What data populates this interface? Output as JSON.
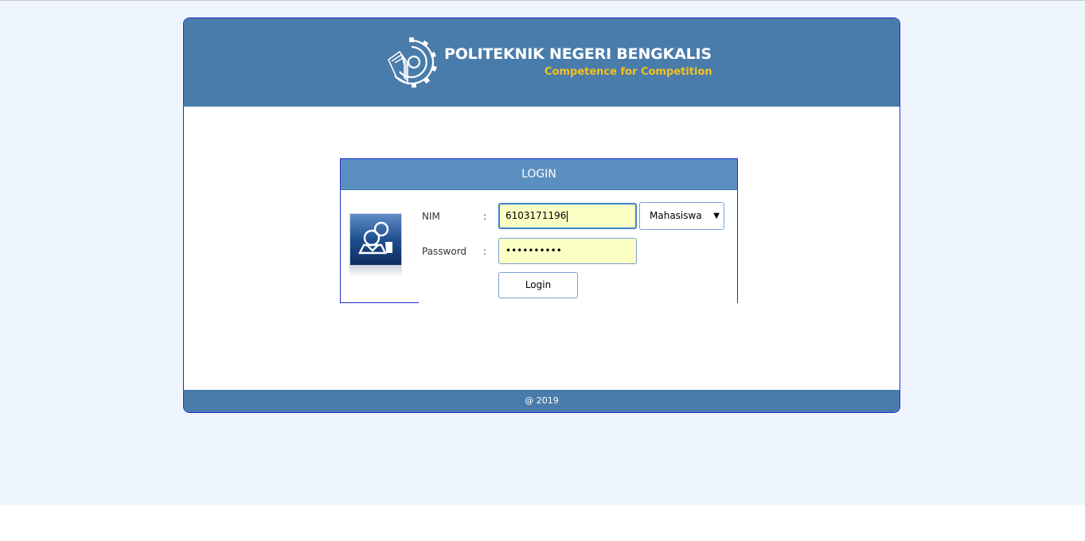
{
  "header": {
    "brand_name": "POLITEKNIK NEGERI BENGKALIS",
    "tagline": "Competence for Competition",
    "logo_icon": "gear-book-emblem-icon"
  },
  "login": {
    "title": "LOGIN",
    "user_icon": "users-icon",
    "nim_label": "NIM",
    "password_label": "Password",
    "separator": ":",
    "nim_value": "6103171196",
    "password_masked": "••••••••••",
    "role_selected": "Mahasiswa",
    "role_arrow": "▼",
    "submit_label": "Login"
  },
  "footer": {
    "text": "@ 2019"
  },
  "colors": {
    "header_bg": "#4a7cab",
    "login_head_bg": "#5b8fc0",
    "tagline": "#f5c11c",
    "input_bg": "#fcffc4",
    "page_bg": "#eef5fd"
  }
}
